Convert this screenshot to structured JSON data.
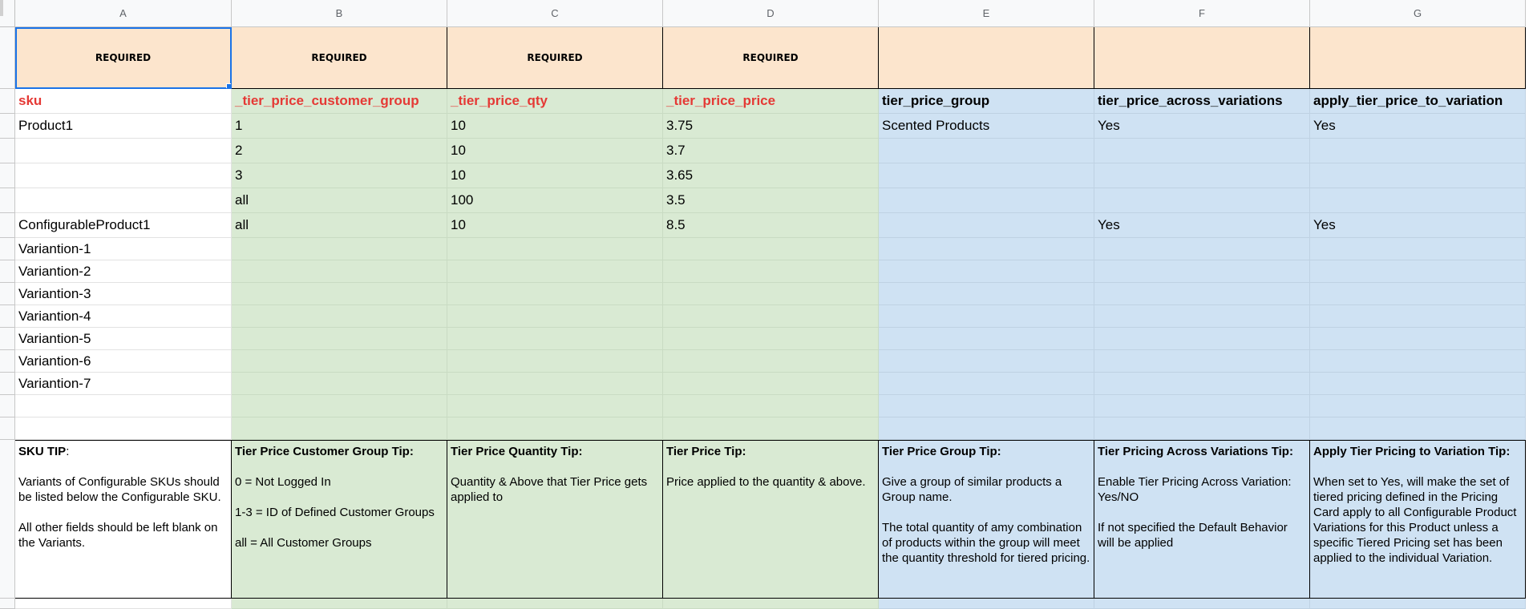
{
  "columns": [
    "A",
    "B",
    "C",
    "D",
    "E",
    "F",
    "G"
  ],
  "required_row": [
    "REQUIRED",
    "REQUIRED",
    "REQUIRED",
    "REQUIRED",
    "",
    "",
    ""
  ],
  "header_row": [
    "sku",
    "_tier_price_customer_group",
    "_tier_price_qty",
    "_tier_price_price",
    "tier_price_group",
    "tier_price_across_variations",
    "apply_tier_price_to_variation"
  ],
  "rows": [
    [
      "Product1",
      "1",
      "10",
      "3.75",
      "Scented Products",
      "Yes",
      "Yes"
    ],
    [
      "",
      "2",
      "10",
      "3.7",
      "",
      "",
      ""
    ],
    [
      "",
      "3",
      "10",
      "3.65",
      "",
      "",
      ""
    ],
    [
      "",
      "all",
      "100",
      "3.5",
      "",
      "",
      ""
    ],
    [
      "ConfigurableProduct1",
      "all",
      "10",
      "8.5",
      "",
      "Yes",
      "Yes"
    ],
    [
      "Variantion-1",
      "",
      "",
      "",
      "",
      "",
      ""
    ],
    [
      "Variantion-2",
      "",
      "",
      "",
      "",
      "",
      ""
    ],
    [
      "Variantion-3",
      "",
      "",
      "",
      "",
      "",
      ""
    ],
    [
      "Variantion-4",
      "",
      "",
      "",
      "",
      "",
      ""
    ],
    [
      "Variantion-5",
      "",
      "",
      "",
      "",
      "",
      ""
    ],
    [
      "Variantion-6",
      "",
      "",
      "",
      "",
      "",
      ""
    ],
    [
      "Variantion-7",
      "",
      "",
      "",
      "",
      "",
      ""
    ],
    [
      "",
      "",
      "",
      "",
      "",
      "",
      ""
    ],
    [
      "",
      "",
      "",
      "",
      "",
      "",
      ""
    ]
  ],
  "tips": [
    {
      "title": "SKU TIP",
      "title_suffix": ":",
      "body": "\nVariants of Configurable SKUs should be listed below the Configurable SKU.\n\nAll other fields should be left blank on the Variants."
    },
    {
      "title": "Tier Price Customer Group Tip:",
      "title_suffix": "",
      "body": "\n0 = Not Logged In\n\n1-3 = ID of Defined Customer Groups\n\nall = All Customer Groups"
    },
    {
      "title": "Tier Price Quantity Tip:",
      "title_suffix": "",
      "body": "\nQuantity & Above that Tier Price gets applied to"
    },
    {
      "title": "Tier Price Tip:",
      "title_suffix": "",
      "body": "\nPrice applied to the quantity & above."
    },
    {
      "title": "Tier Price Group Tip:",
      "title_suffix": "",
      "body": "\nGive a group of similar products a Group name.\n\nThe total quantity of amy combination of products within the group will meet the quantity threshold for tiered pricing."
    },
    {
      "title": "Tier Pricing Across Variations Tip:",
      "title_suffix": "",
      "body": "\nEnable Tier Pricing Across Variation: Yes/NO\n\nIf not specified the Default Behavior will be applied"
    },
    {
      "title": "Apply Tier Pricing to Variation Tip:",
      "title_suffix": "",
      "body": "\nWhen set to Yes, will make the set of tiered pricing defined in the Pricing Card apply to all Configurable Product Variations for this Product unless a specific Tiered Pricing set has been applied to the individual Variation."
    }
  ],
  "colors": {
    "required_fill": "#fce5cd",
    "green_fill": "#d9ead3",
    "blue_fill": "#cfe2f3",
    "red_text": "#e53935",
    "selection": "#1a73e8"
  }
}
